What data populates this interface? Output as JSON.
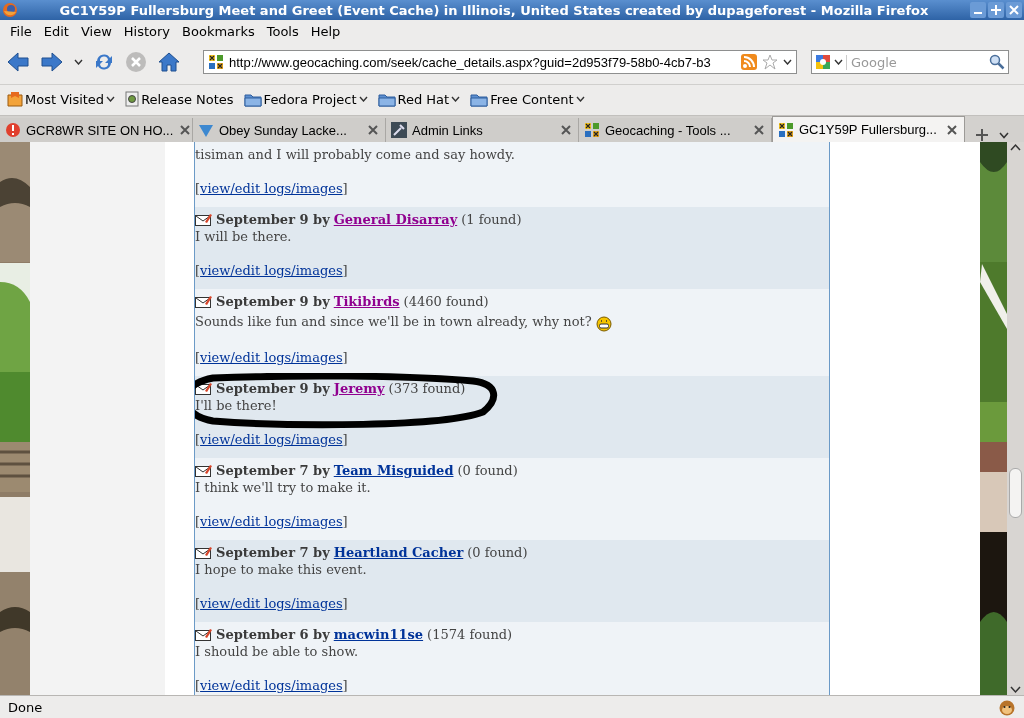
{
  "window": {
    "title": "GC1Y59P Fullersburg Meet and Greet (Event Cache) in Illinois, United States created by dupageforest - Mozilla Firefox"
  },
  "menu": [
    "File",
    "Edit",
    "View",
    "History",
    "Bookmarks",
    "Tools",
    "Help"
  ],
  "navigation": {
    "url": "http://www.geocaching.com/seek/cache_details.aspx?guid=2d953f79-58b0-4cb7-b3",
    "search_placeholder": "Google",
    "stop_disabled": true
  },
  "bookmarks": [
    {
      "label": "Most Visited",
      "kind": "menu"
    },
    {
      "label": "Release Notes",
      "kind": "page"
    },
    {
      "label": "Fedora Project",
      "kind": "folder"
    },
    {
      "label": "Red Hat",
      "kind": "folder"
    },
    {
      "label": "Free Content",
      "kind": "folder"
    }
  ],
  "tabs": [
    {
      "title": "GCR8WR SITE ON HO...",
      "kind": "warning",
      "selected": false
    },
    {
      "title": "Obey Sunday Lacke...",
      "kind": "check",
      "selected": false
    },
    {
      "title": "Admin Links",
      "kind": "tool",
      "selected": false
    },
    {
      "title": "Geocaching - Tools ...",
      "kind": "geocache",
      "selected": false
    },
    {
      "title": "GC1Y59P Fullersburg...",
      "kind": "geocache",
      "selected": true
    }
  ],
  "logs": [
    {
      "text": "tisiman and I will probably come and say howdy.",
      "link_open": "[",
      "link": "view/edit logs/images",
      "link_close": "]",
      "smiley": false,
      "circled": false
    },
    {
      "heading": "September 9 by",
      "author": "General Disarray",
      "visited": true,
      "count": "(1 found)",
      "text": "I will be there.",
      "link_open": "[",
      "link": "view/edit logs/images",
      "link_close": "]",
      "smiley": false,
      "circled": false
    },
    {
      "heading": "September 9 by",
      "author": "Tikibirds",
      "visited": true,
      "count": "(4460 found)",
      "text": "Sounds like fun and since we'll be in town already, why not?",
      "link_open": "[",
      "link": "view/edit logs/images",
      "link_close": "]",
      "smiley": true,
      "circled": false
    },
    {
      "heading": "September 9 by",
      "author": "Jeremy",
      "visited": true,
      "count": "(373 found)",
      "text": "I'll be there!",
      "link_open": "[",
      "link": "view/edit logs/images",
      "link_close": "]",
      "smiley": false,
      "circled": true
    },
    {
      "heading": "September 7 by",
      "author": "Team Misguided",
      "visited": false,
      "count": "(0 found)",
      "text": "I think we'll try to make it.",
      "link_open": "[",
      "link": "view/edit logs/images",
      "link_close": "]",
      "smiley": false,
      "circled": false
    },
    {
      "heading": "September 7 by",
      "author": "Heartland Cacher",
      "visited": false,
      "count": "(0 found)",
      "text": "I hope to make this event.",
      "link_open": "[",
      "link": "view/edit logs/images",
      "link_close": "]",
      "smiley": false,
      "circled": false
    },
    {
      "heading": "September 6 by",
      "author": "macwin11se",
      "visited": false,
      "count": "(1574 found)",
      "text": "I should be able to show.",
      "link_open": "[",
      "link": "view/edit logs/images",
      "link_close": "]",
      "smiley": false,
      "circled": false
    }
  ],
  "status_bar": {
    "text": "Done"
  }
}
